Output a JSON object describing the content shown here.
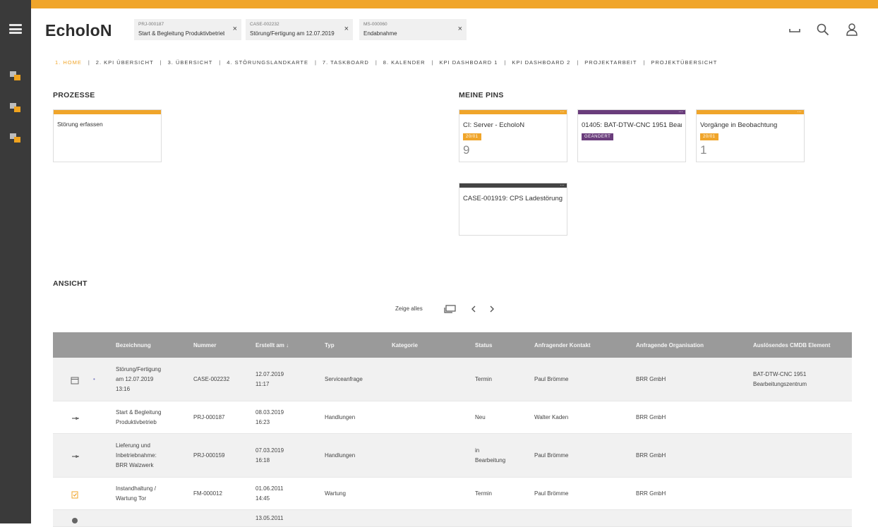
{
  "app": {
    "logo": "EcholoN"
  },
  "open_tabs": [
    {
      "code": "PRJ-000187",
      "name": "Start & Begleitung Produktivbetrieb"
    },
    {
      "code": "CASE-002232",
      "name": "Störung/Fertigung am 12.07.2019"
    },
    {
      "code": "MS-000060",
      "name": "Endabnahme"
    }
  ],
  "tab_close_label": "×",
  "header_icons": [
    "minimize-icon",
    "search-icon",
    "user-icon"
  ],
  "sidebar_icons": [
    "module-icon-1",
    "module-icon-2",
    "module-icon-3"
  ],
  "nav": [
    {
      "label": "1. HOME",
      "active": true
    },
    {
      "label": "2. KPI ÜBERSICHT"
    },
    {
      "label": "3. ÜBERSICHT"
    },
    {
      "label": "4. STÖRUNGSLANDKARTE"
    },
    {
      "label": "7. TASKBOARD"
    },
    {
      "label": "8. KALENDER"
    },
    {
      "label": "KPI DASHBOARD 1"
    },
    {
      "label": "KPI DASHBOARD 2"
    },
    {
      "label": "PROJEKTARBEIT"
    },
    {
      "label": "PROJEKTÜBERSICHT"
    }
  ],
  "nav_separator": "|",
  "prozesse": {
    "title": "PROZESSE",
    "cards": [
      {
        "title": "Störung erfassen"
      }
    ]
  },
  "pins": {
    "title": "MEINE PINS",
    "cards": [
      {
        "title": "CI: Server - EcholoN",
        "badge": "20/01",
        "count": "9",
        "color": "#f0a52a",
        "badge_color": "#f0a52a"
      },
      {
        "title": "01405: BAT-DTW-CNC 1951 Bearbeitungszentrum",
        "badge": "GEÄNDERT",
        "count": "",
        "color": "#6a3d7c",
        "badge_color": "#6a3d7c"
      },
      {
        "title": "Vorgänge in Beobachtung",
        "badge": "20/01",
        "count": "1",
        "color": "#f0a52a",
        "badge_color": "#f0a52a"
      },
      {
        "title": "CASE-001919: CPS Ladestörung",
        "badge": "",
        "count": "",
        "color": "#444444",
        "badge_color": ""
      }
    ],
    "dots": "…"
  },
  "ansicht": {
    "title": "ANSICHT",
    "show_all": "Zeige alles",
    "pager_icons": [
      "screen-icon",
      "prev-icon",
      "next-icon"
    ]
  },
  "table": {
    "columns": [
      "Bezeichnung",
      "Nummer",
      "Erstellt am ↓",
      "Typ",
      "Kategorie",
      "Status",
      "Anfragender Kontakt",
      "Anfragende Organisation",
      "Auslösendes CMDB Element"
    ],
    "rows": [
      {
        "icon": "calendar-icon",
        "dot": "•",
        "bez": [
          "Störung/Fertigung",
          "am 12.07.2019",
          "13:16"
        ],
        "nummer": "CASE-002232",
        "erstellt": [
          "12.07.2019",
          "11:17"
        ],
        "typ": "Serviceanfrage",
        "kategorie": "",
        "status": [
          "Termin"
        ],
        "kontakt": "Paul Brömme",
        "org": "BRR GmbH",
        "cmdb": [
          "BAT-DTW-CNC 1951",
          "Bearbeitungszentrum"
        ]
      },
      {
        "icon": "pin-icon",
        "dot": "",
        "bez": [
          "Start & Begleitung",
          "Produktivbetrieb"
        ],
        "nummer": "PRJ-000187",
        "erstellt": [
          "08.03.2019",
          "16:23"
        ],
        "typ": "Handlungen",
        "kategorie": "",
        "status": [
          "Neu"
        ],
        "kontakt": "Walter Kaden",
        "org": "BRR GmbH",
        "cmdb": []
      },
      {
        "icon": "pin-icon",
        "dot": "",
        "bez": [
          "Lieferung und",
          "Inbetriebnahme:",
          "BRR Walzwerk"
        ],
        "nummer": "PRJ-000159",
        "erstellt": [
          "07.03.2019",
          "16:18"
        ],
        "typ": "Handlungen",
        "kategorie": "",
        "status": [
          "in",
          "Bearbeitung"
        ],
        "kontakt": "Paul Brömme",
        "org": "BRR GmbH",
        "cmdb": []
      },
      {
        "icon": "maintenance-icon",
        "dot": "",
        "bez": [
          "Instandhaltung /",
          "Wartung Tor"
        ],
        "nummer": "FM-000012",
        "erstellt": [
          "01.06.2011",
          "14:45"
        ],
        "typ": "Wartung",
        "kategorie": "",
        "status": [
          "Termin"
        ],
        "kontakt": "Paul Brömme",
        "org": "BRR GmbH",
        "cmdb": []
      },
      {
        "icon": "generic-icon",
        "dot": "",
        "bez": [
          ""
        ],
        "nummer": "",
        "erstellt": [
          "13.05.2011"
        ],
        "typ": "",
        "kategorie": "",
        "status": [
          ""
        ],
        "kontakt": "",
        "org": "",
        "cmdb": []
      }
    ]
  }
}
